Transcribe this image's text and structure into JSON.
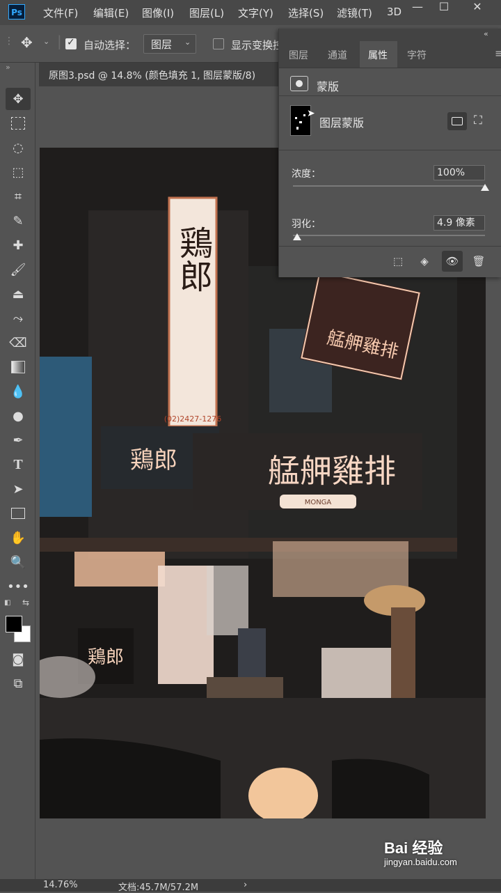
{
  "app": {
    "logo": "Ps"
  },
  "menu": [
    "文件(F)",
    "编辑(E)",
    "图像(I)",
    "图层(L)",
    "文字(Y)",
    "选择(S)",
    "滤镜(T)",
    "3D"
  ],
  "window_controls": {
    "minimize": "—",
    "maximize": "☐",
    "close": "✕"
  },
  "options": {
    "auto_select_label": "自动选择：",
    "auto_select_checked": true,
    "auto_select_target": "图层",
    "show_transform_label": "显示变换控",
    "show_transform_checked": false
  },
  "document_tab": "原图3.psd @ 14.8% (颜色填充 1, 图层蒙版/8)",
  "properties_panel": {
    "tabs": [
      "图层",
      "通道",
      "属性",
      "字符"
    ],
    "active_tab": "属性",
    "mask_section_title": "蒙版",
    "layer_mask_label": "图层蒙版",
    "density_label": "浓度：",
    "density_value": "100%",
    "density_level": 1.0,
    "feather_label": "羽化：",
    "feather_value": "4.9 像素",
    "feather_level": 0.02
  },
  "canvas_photo": {
    "signs": [
      "鶏郎",
      "鶏郎",
      "艋舺雞排",
      "艋舺雞排",
      "MONGA",
      "鶏郎"
    ],
    "phone": "(02)2427-1276"
  },
  "status": {
    "zoom": "14.76%",
    "doc_size": "文档:45.7M/57.2M",
    "arrow": "›"
  },
  "watermark": {
    "main": "Bai 经验",
    "sub": "jingyan.baidu.com"
  },
  "colors": {
    "accent": "#31a8ff",
    "neon": "#f6c9ae",
    "panel": "#535353"
  }
}
